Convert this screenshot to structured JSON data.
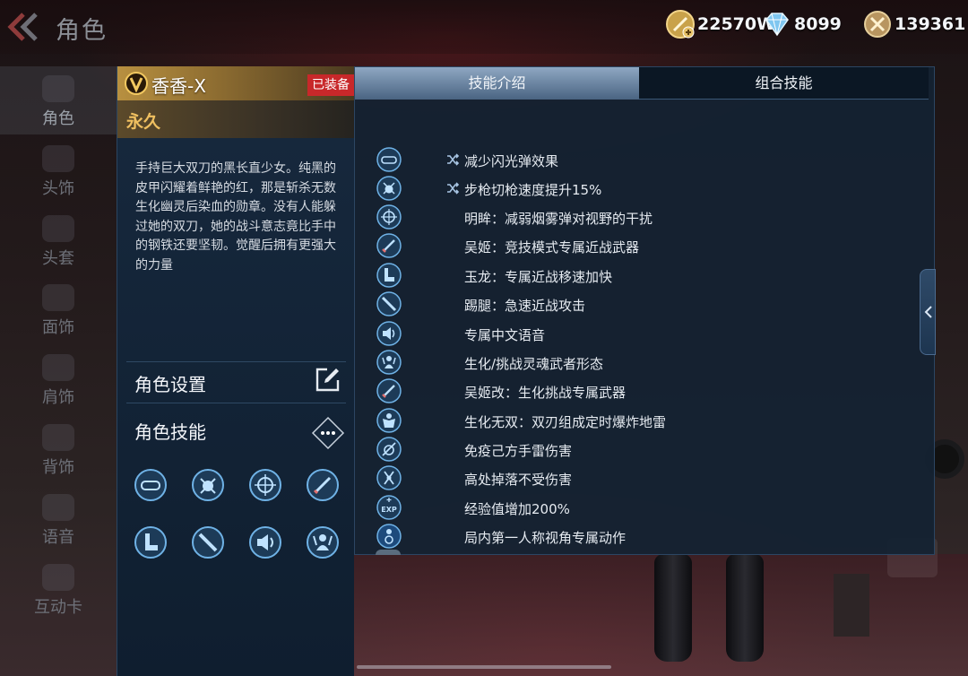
{
  "header": {
    "title": "角色",
    "currencies": [
      {
        "name": "gold",
        "value": "22570W"
      },
      {
        "name": "diamond",
        "value": "8099"
      },
      {
        "name": "coupon",
        "value": "139361"
      }
    ]
  },
  "nav": {
    "items": [
      {
        "label": "角色"
      },
      {
        "label": "头饰"
      },
      {
        "label": "头套"
      },
      {
        "label": "面饰"
      },
      {
        "label": "肩饰"
      },
      {
        "label": "背饰"
      },
      {
        "label": "语音"
      },
      {
        "label": "互动卡"
      }
    ]
  },
  "character": {
    "name": "香香-X",
    "badge": "已装备",
    "duration": "永久",
    "description": "手持巨大双刀的黑长直少女。纯黑的皮甲闪耀着鲜艳的红，那是斩杀无数生化幽灵后染血的勋章。没有人能躲过她的双刀，她的战斗意志竟比手中的钢铁还要坚韧。觉醒后拥有更强大的力量",
    "settings_label": "角色设置",
    "skills_label": "角色技能",
    "skill_icons": [
      "goggles-icon",
      "bug-icon",
      "crosshair-icon",
      "blade-icon",
      "boot-icon",
      "knife-icon",
      "speaker-icon",
      "soul-icon"
    ]
  },
  "tabs": {
    "intro": "技能介绍",
    "combo": "组合技能"
  },
  "skills": [
    {
      "icon": "goggles-icon",
      "shuffle": true,
      "text": "减少闪光弹效果"
    },
    {
      "icon": "bug-icon",
      "shuffle": true,
      "text": "步枪切枪速度提升15%"
    },
    {
      "icon": "crosshair-icon",
      "shuffle": false,
      "text": "明眸：减弱烟雾弹对视野的干扰"
    },
    {
      "icon": "blade-icon",
      "shuffle": false,
      "text": "吴姬：竞技模式专属近战武器"
    },
    {
      "icon": "boot-icon",
      "shuffle": false,
      "text": "玉龙：专属近战移速加快"
    },
    {
      "icon": "knife-icon",
      "shuffle": false,
      "text": "踢腿：急速近战攻击"
    },
    {
      "icon": "speaker-icon",
      "shuffle": false,
      "text": "专属中文语音"
    },
    {
      "icon": "soul-icon",
      "shuffle": false,
      "text": "生化/挑战灵魂武者形态"
    },
    {
      "icon": "blade-icon",
      "shuffle": false,
      "text": "吴姬改：生化挑战专属武器"
    },
    {
      "icon": "warrior-icon",
      "shuffle": false,
      "text": "生化无双：双刃组成定时爆炸地雷"
    },
    {
      "icon": "grenade-icon",
      "shuffle": false,
      "text": "免疫己方手雷伤害"
    },
    {
      "icon": "fall-icon",
      "shuffle": false,
      "text": "高处掉落不受伤害"
    },
    {
      "icon": "exp-icon",
      "shuffle": false,
      "text": "经验值增加200%"
    },
    {
      "icon": "firstperson-icon",
      "shuffle": false,
      "text": "局内第一人称视角专属动作"
    }
  ],
  "colors": {
    "panel": "#14223a",
    "accent_gold": "#f0c060",
    "badge_red": "#c8282a"
  }
}
